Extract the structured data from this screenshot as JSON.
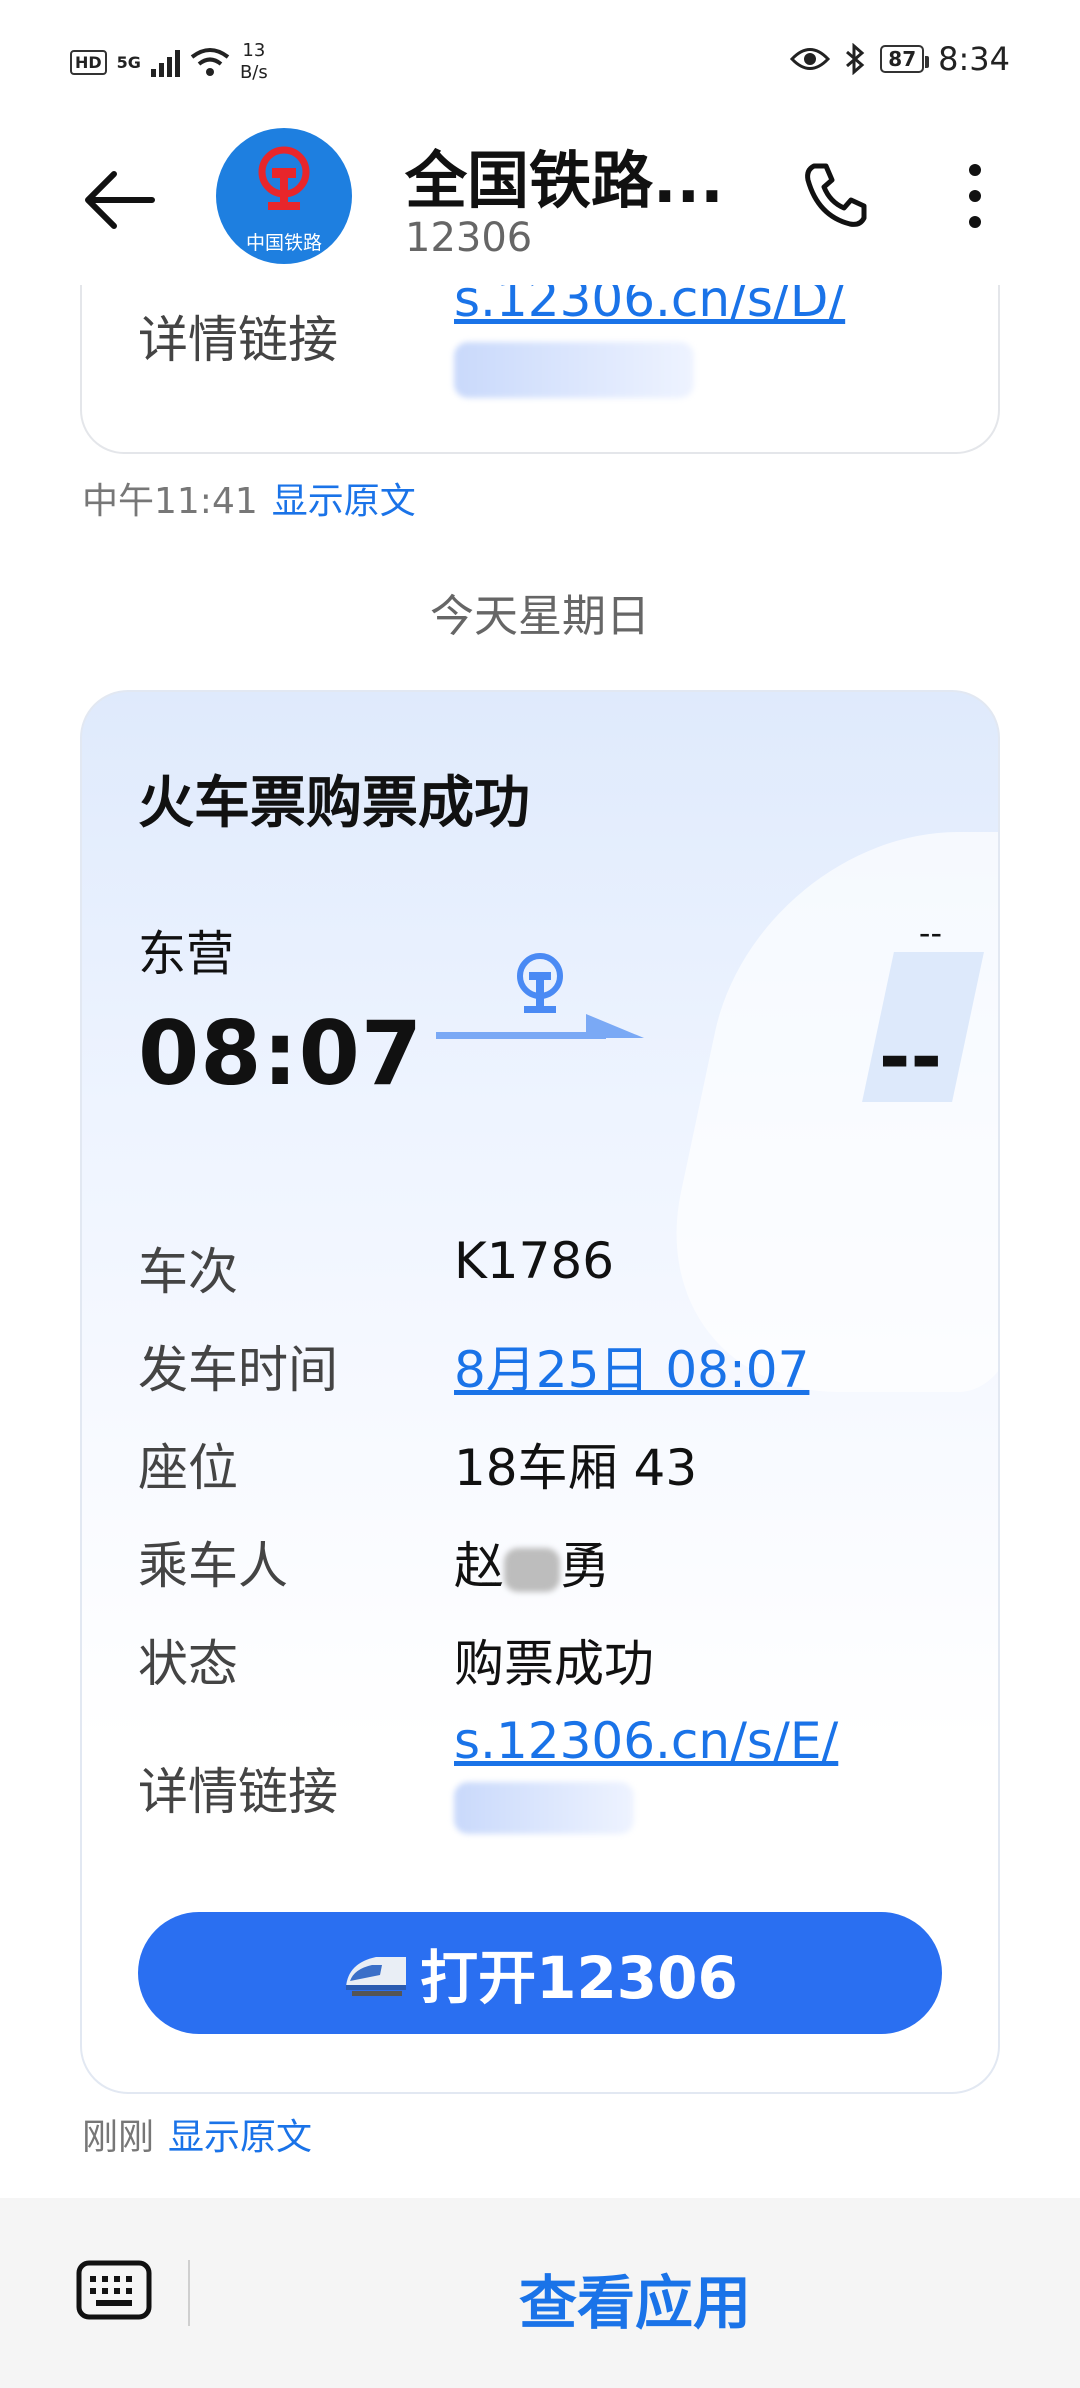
{
  "status_bar": {
    "hd": "HD",
    "net": "5G",
    "speed_value": "13",
    "speed_unit": "B/s",
    "battery": "87",
    "time": "8:34"
  },
  "header": {
    "title": "全国铁路...",
    "subtitle": "12306",
    "avatar_caption": "中国铁路"
  },
  "previous_message": {
    "label": "详情链接",
    "link": "s.12306.cn/s/D/",
    "time": "中午11:41",
    "show_raw": "显示原文"
  },
  "date_divider": "今天星期日",
  "ticket": {
    "title": "火车票购票成功",
    "from_station": "东营",
    "from_time": "08:07",
    "to_station": "--",
    "to_time": "--",
    "rows": [
      {
        "key": "车次",
        "value": "K1786"
      },
      {
        "key": "发车时间",
        "value": "8月25日 08:07"
      },
      {
        "key": "座位",
        "value": "18车厢 43"
      },
      {
        "key": "乘车人",
        "value_left": "赵",
        "value_right": "勇"
      },
      {
        "key": "状态",
        "value": "购票成功"
      },
      {
        "key": "详情链接",
        "value": "s.12306.cn/s/E/"
      }
    ],
    "button": "打开12306"
  },
  "ticket_meta": {
    "time": "刚刚",
    "show_raw": "显示原文"
  },
  "bottom_bar": {
    "view_app": "查看应用"
  },
  "colors": {
    "accent": "#1a73e8",
    "button": "#2a6ff1",
    "avatar": "#1e7fe0"
  }
}
